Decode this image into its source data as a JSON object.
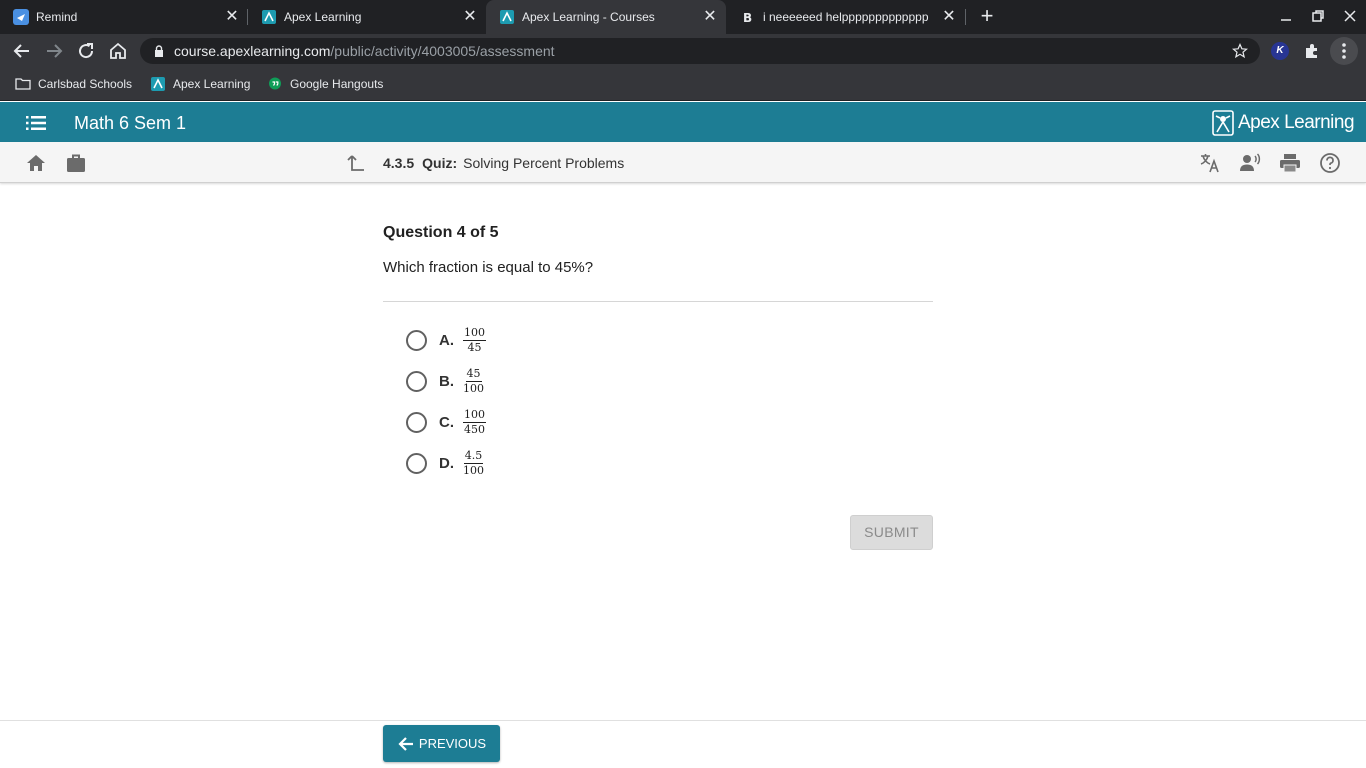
{
  "browser": {
    "tabs": [
      {
        "title": "Remind",
        "icon": "remind-icon",
        "active": false
      },
      {
        "title": "Apex Learning",
        "icon": "apex-icon",
        "active": false
      },
      {
        "title": "Apex Learning - Courses",
        "icon": "apex-icon",
        "active": true
      },
      {
        "title": "i neeeeeed helppppppppppppp",
        "icon": "brainly-icon",
        "active": false
      }
    ],
    "url_host": "course.apexlearning.com",
    "url_path": "/public/activity/4003005/assessment",
    "bookmarks": [
      {
        "label": "Carlsbad Schools",
        "icon": "folder-icon"
      },
      {
        "label": "Apex Learning",
        "icon": "apex-icon"
      },
      {
        "label": "Google Hangouts",
        "icon": "hangouts-icon"
      }
    ],
    "extension_label": "K"
  },
  "header": {
    "course_title": "Math 6 Sem 1",
    "logo_text": "Apex Learning",
    "brand_color": "#1d7d94"
  },
  "subnav": {
    "lesson_number": "4.3.5",
    "activity_type": "Quiz:",
    "activity_title": "Solving Percent Problems"
  },
  "quiz": {
    "heading": "Question 4 of 5",
    "prompt": "Which fraction is equal to 45%?",
    "choices": [
      {
        "letter": "A.",
        "numerator": "100",
        "denominator": "45",
        "selected": false
      },
      {
        "letter": "B.",
        "numerator": "45",
        "denominator": "100",
        "selected": false
      },
      {
        "letter": "C.",
        "numerator": "100",
        "denominator": "450",
        "selected": false
      },
      {
        "letter": "D.",
        "numerator": "4.5",
        "denominator": "100",
        "selected": false
      }
    ],
    "submit_label": "SUBMIT",
    "previous_label": "PREVIOUS"
  }
}
